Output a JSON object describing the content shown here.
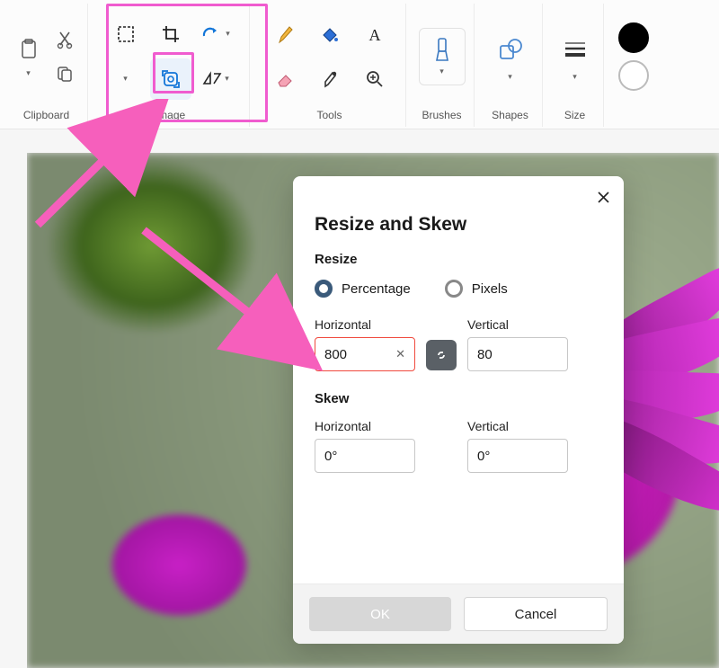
{
  "ribbon": {
    "clipboard": {
      "label": "Clipboard"
    },
    "image": {
      "label": "Image"
    },
    "tools": {
      "label": "Tools"
    },
    "brushes": {
      "label": "Brushes"
    },
    "shapes": {
      "label": "Shapes"
    },
    "size": {
      "label": "Size"
    },
    "color1": "#000000",
    "color2": "#ffffff"
  },
  "dialog": {
    "title": "Resize and Skew",
    "resize_label": "Resize",
    "unit_percentage": "Percentage",
    "unit_pixels": "Pixels",
    "unit_selected": "percentage",
    "horizontal_label": "Horizontal",
    "vertical_label": "Vertical",
    "resize_horizontal_value": "800",
    "resize_vertical_value": "80",
    "resize_horizontal_invalid": true,
    "link_aspect_locked": true,
    "skew_label": "Skew",
    "skew_horizontal_value": "0°",
    "skew_vertical_value": "0°",
    "ok_label": "OK",
    "cancel_label": "Cancel"
  }
}
